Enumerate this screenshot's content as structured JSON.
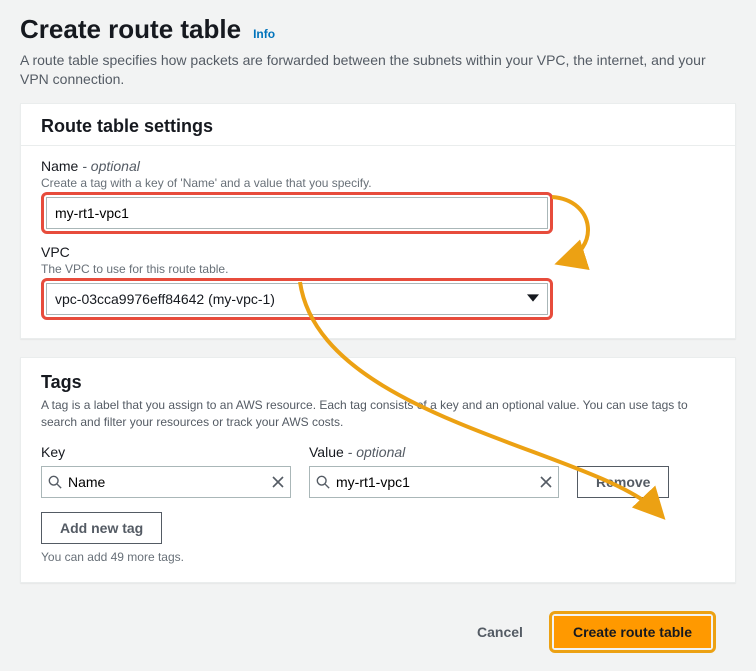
{
  "header": {
    "title": "Create route table",
    "info": "Info",
    "description": "A route table specifies how packets are forwarded between the subnets within your VPC, the internet, and your VPN connection."
  },
  "settings": {
    "panel_title": "Route table settings",
    "name": {
      "label": "Name",
      "optional_suffix": " - optional",
      "hint": "Create a tag with a key of 'Name' and a value that you specify.",
      "value": "my-rt1-vpc1"
    },
    "vpc": {
      "label": "VPC",
      "hint": "The VPC to use for this route table.",
      "selected": "vpc-03cca9976eff84642 (my-vpc-1)"
    }
  },
  "tags": {
    "panel_title": "Tags",
    "description": "A tag is a label that you assign to an AWS resource. Each tag consists of a key and an optional value. You can use tags to search and filter your resources or track your AWS costs.",
    "key_label": "Key",
    "value_label": "Value",
    "value_optional_suffix": " - optional",
    "row": {
      "key": "Name",
      "value": "my-rt1-vpc1"
    },
    "remove_label": "Remove",
    "add_label": "Add new tag",
    "remaining_note": "You can add 49 more tags."
  },
  "footer": {
    "cancel": "Cancel",
    "submit": "Create route table"
  }
}
